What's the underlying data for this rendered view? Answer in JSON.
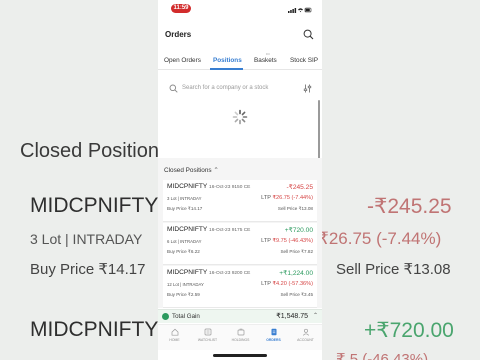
{
  "status_bar": {
    "time": "11:59"
  },
  "header": {
    "title": "Orders"
  },
  "tabs": [
    {
      "label": "Open Orders"
    },
    {
      "label": "Positions"
    },
    {
      "label": "Baskets"
    },
    {
      "label": "Stock SIP"
    }
  ],
  "search": {
    "placeholder": "Search for a company or a stock"
  },
  "closed_positions": {
    "header": "Closed Positions",
    "items": [
      {
        "symbol": "MIDCPNIFTY",
        "expiry": "16-Oct-23 9150 CE",
        "pnl": "-₹245.25",
        "lot": "3 Lot | INTRADAY",
        "ltp_label": "LTP",
        "ltp": "₹26.75 (-7.44%)",
        "buy": "Buy Price ₹14.17",
        "sell": "Sell Price ₹13.08",
        "pnl_color": "#d64545",
        "ltp_color": "#d64545"
      },
      {
        "symbol": "MIDCPNIFTY",
        "expiry": "16-Oct-23 9175 CE",
        "pnl": "+₹720.00",
        "lot": "6 Lot | INTRADAY",
        "ltp_label": "LTP",
        "ltp": "₹9.75 (-46.43%)",
        "buy": "Buy Price ₹6.22",
        "sell": "Sell Price ₹7.82",
        "pnl_color": "#2b9a5e",
        "ltp_color": "#d64545"
      },
      {
        "symbol": "MIDCPNIFTY",
        "expiry": "16-Oct-23 9200 CE",
        "pnl": "+₹1,224.00",
        "lot": "12 Lot | INTRADAY",
        "ltp_label": "LTP",
        "ltp": "₹4.20 (-57.36%)",
        "buy": "Buy Price ₹2.59",
        "sell": "Sell Price ₹3.45",
        "pnl_color": "#2b9a5e",
        "ltp_color": "#d64545"
      }
    ]
  },
  "total_gain": {
    "label": "Total Gain",
    "value": "₹1,548.75"
  },
  "bottom_nav": [
    {
      "label": "HOME",
      "icon": "home-icon"
    },
    {
      "label": "WATCHLIST",
      "icon": "watchlist-icon"
    },
    {
      "label": "HOLDINGS",
      "icon": "holdings-icon"
    },
    {
      "label": "ORDERS",
      "icon": "orders-icon"
    },
    {
      "label": "ACCOUNT",
      "icon": "account-icon"
    }
  ],
  "background_zoom": {
    "heading": "Closed Position",
    "row1_symbol": "MIDCPNIFTY",
    "row1_pnl": "-₹245.25",
    "row1_lot": "3 Lot | INTRADAY",
    "row1_ltp": "₹26.75 (-7.44%)",
    "row1_buy": "Buy Price ₹14.17",
    "row1_sell": "Sell Price ₹13.08",
    "row2_symbol": "MIDCPNIFTY",
    "row2_pnl": "+₹720.00",
    "row2_ltp": "₹ 5 (-46.43%)"
  },
  "colors": {
    "accent": "#387ed1",
    "loss": "#d64545",
    "gain": "#2b9a5e",
    "status_pill": "#d22c2c"
  }
}
